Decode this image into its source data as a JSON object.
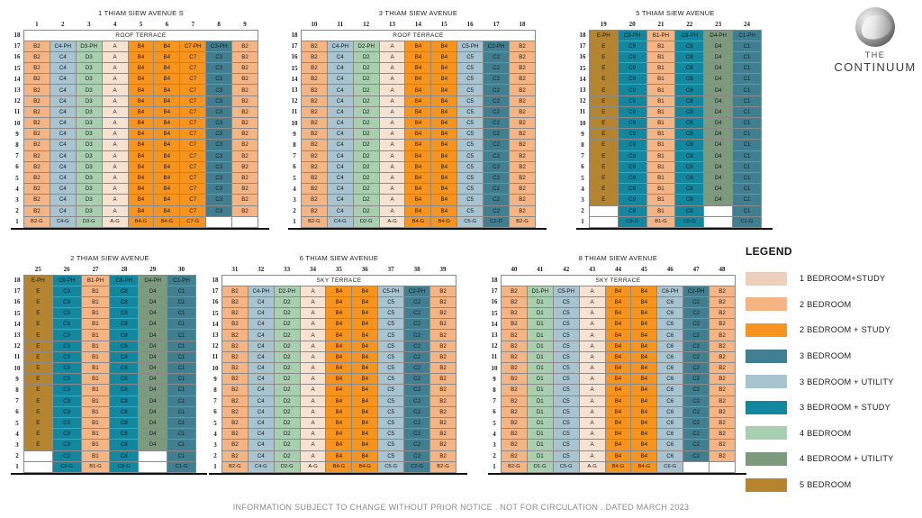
{
  "logo": {
    "line1": "THE",
    "line2": "CONTINUUM",
    "mark": "circular-swirl-logo"
  },
  "footer": {
    "text": "INFORMATION SUBJECT TO CHANGE WITHOUT PRIOR NOTICE . NOT FOR CIRCULATION . DATED MARCH 2023"
  },
  "legend": {
    "title": "LEGEND",
    "items": [
      {
        "label": "1 BEDROOM+STUDY",
        "color": "#ecd0bb"
      },
      {
        "label": "2 BEDROOM",
        "color": "#f5b483"
      },
      {
        "label": "2 BEDROOM + STUDY",
        "color": "#f7941e"
      },
      {
        "label": "3 BEDROOM",
        "color": "#3f7f91"
      },
      {
        "label": "3 BEDROOM + UTILITY",
        "color": "#a8c4d0"
      },
      {
        "label": "3 BEDROOM + STUDY",
        "color": "#1287a0"
      },
      {
        "label": "4 BEDROOM",
        "color": "#a8cfb0"
      },
      {
        "label": "4 BEDROOM + UTILITY",
        "color": "#7d9a7f"
      },
      {
        "label": "5 BEDROOM",
        "color": "#b5842f"
      }
    ]
  },
  "palette": {
    "one_bed_study": "#f7e2d2",
    "two_bed": "#f5b483",
    "two_bed_study": "#f7941e",
    "three_bed": "#3f7f91",
    "three_bed_utility": "#a8c4d0",
    "three_bed_study": "#1287a0",
    "four_bed": "#a8cfb0",
    "four_bed_utility": "#7d9a7f",
    "five_bed": "#b5842f",
    "empty": "#ffffff"
  },
  "unit_colors": {
    "A": "#f7e2d2",
    "B1": "#f5b483",
    "B2": "#f5b483",
    "B4": "#f7941e",
    "C1": "#3f7f91",
    "C2": "#3f7f91",
    "C3": "#3f7f91",
    "C4": "#a8c4d0",
    "C5": "#a8c4d0",
    "C6": "#a8c4d0",
    "C7": "#f7941e",
    "C8": "#1287a0",
    "C9": "#1287a0",
    "D1": "#a8cfb0",
    "D2": "#a8cfb0",
    "D3": "#a8cfb0",
    "D4": "#7d9a7f",
    "E": "#b5842f"
  },
  "blocks": [
    {
      "id": "block-1-thiam-siew-avenue-s",
      "title": "1 THIAM SIEW AVENUE S",
      "columns": [
        "1",
        "2",
        "3",
        "4",
        "5",
        "6",
        "7",
        "8",
        "9"
      ],
      "terrace_label": "ROOF TERRACE",
      "terrace_row": "18",
      "rows": [
        "17",
        "16",
        "15",
        "14",
        "13",
        "12",
        "11",
        "10",
        "9",
        "8",
        "7",
        "6",
        "5",
        "4",
        "3",
        "2"
      ],
      "ground_row": "1",
      "ph": [
        "B2",
        "C4-PH",
        "D3-PH",
        "A",
        "B4",
        "B4",
        "C7-PH",
        "C3-PH",
        "B2"
      ],
      "typical": [
        "B2",
        "C4",
        "D3",
        "A",
        "B4",
        "B4",
        "C7",
        "C3",
        "B2"
      ],
      "ground": [
        "B2-G",
        "C4-G",
        "D3-G",
        "A-G",
        "B4-G",
        "B4-G",
        "C7-G",
        "",
        ""
      ],
      "types": [
        "B2",
        "C4",
        "D3",
        "A",
        "B4",
        "B4",
        "C7",
        "C3",
        "B2"
      ]
    },
    {
      "id": "block-3-thiam-siew-avenue",
      "title": "3 THIAM SIEW AVENUE",
      "columns": [
        "10",
        "11",
        "12",
        "13",
        "14",
        "15",
        "16",
        "17",
        "18"
      ],
      "terrace_label": "ROOF TERRACE",
      "terrace_row": "18",
      "rows": [
        "17",
        "16",
        "15",
        "14",
        "13",
        "12",
        "11",
        "10",
        "9",
        "8",
        "7",
        "6",
        "5",
        "4",
        "3",
        "2"
      ],
      "ground_row": "1",
      "ph": [
        "B2",
        "C4-PH",
        "D2-PH",
        "A",
        "B4",
        "B4",
        "C5-PH",
        "C2-PH",
        "B2"
      ],
      "typical": [
        "B2",
        "C4",
        "D2",
        "A",
        "B4",
        "B4",
        "C5",
        "C2",
        "B2"
      ],
      "ground": [
        "B2-G",
        "C4-G",
        "D2-G",
        "A-G",
        "B4-G",
        "B4-G",
        "C5-G",
        "C2-G",
        "B2-G"
      ],
      "types": [
        "B2",
        "C4",
        "D2",
        "A",
        "B4",
        "B4",
        "C5",
        "C2",
        "B2"
      ]
    },
    {
      "id": "block-5-thiam-siew-avenue",
      "title": "5 THIAM SIEW AVENUE",
      "columns": [
        "19",
        "20",
        "21",
        "22",
        "23",
        "24"
      ],
      "terrace_label": "",
      "terrace_row": "18",
      "rows": [
        "17",
        "16",
        "15",
        "14",
        "13",
        "12",
        "11",
        "10",
        "9",
        "8",
        "7",
        "6",
        "5",
        "4",
        "3",
        "2"
      ],
      "ground_row": "1",
      "ph": [
        "E-PH",
        "C9-PH",
        "B1-PH",
        "C8-PH",
        "D4-PH",
        "C1-PH"
      ],
      "typical": [
        "E",
        "C9",
        "B1",
        "C8",
        "D4",
        "C1"
      ],
      "second": [
        "",
        "C9",
        "B1",
        "C8",
        "",
        "C1"
      ],
      "ground": [
        "",
        "C9-G",
        "B1-G",
        "C8-G",
        "",
        "C1-G"
      ],
      "types": [
        "E",
        "C9",
        "B1",
        "C8",
        "D4",
        "C1"
      ]
    },
    {
      "id": "block-2-thiam-siew-avenue",
      "title": "2 THIAM SIEW AVENUE",
      "columns": [
        "25",
        "26",
        "27",
        "28",
        "29",
        "30"
      ],
      "terrace_label": "",
      "terrace_row": "18",
      "rows": [
        "17",
        "16",
        "15",
        "14",
        "13",
        "12",
        "11",
        "10",
        "9",
        "8",
        "7",
        "6",
        "5",
        "4",
        "3",
        "2"
      ],
      "ground_row": "1",
      "ph": [
        "E-PH",
        "C9-PH",
        "B1-PH",
        "C8-PH",
        "D4-PH",
        "C1-PH"
      ],
      "typical": [
        "E",
        "C9",
        "B1",
        "C8",
        "D4",
        "C1"
      ],
      "second": [
        "",
        "C9",
        "B1",
        "C8",
        "",
        "C1"
      ],
      "ground": [
        "",
        "C9-G",
        "B1-G",
        "C8-G",
        "",
        "C1-G"
      ],
      "types": [
        "E",
        "C9",
        "B1",
        "C8",
        "D4",
        "C1"
      ]
    },
    {
      "id": "block-6-thiam-siew-avenue",
      "title": "6 THIAM SIEW AVENUE",
      "columns": [
        "31",
        "32",
        "33",
        "34",
        "35",
        "36",
        "37",
        "38",
        "39"
      ],
      "terrace_label": "SKY TERRACE",
      "terrace_row": "18",
      "rows": [
        "17",
        "16",
        "15",
        "14",
        "13",
        "12",
        "11",
        "10",
        "9",
        "8",
        "7",
        "6",
        "5",
        "4",
        "3",
        "2"
      ],
      "ground_row": "1",
      "ph": [
        "B2",
        "C4-PH",
        "D2-PH",
        "A",
        "B4",
        "B4",
        "C5-PH",
        "C2-PH",
        "B2"
      ],
      "typical": [
        "B2",
        "C4",
        "D2",
        "A",
        "B4",
        "B4",
        "C5",
        "C2",
        "B2"
      ],
      "ground": [
        "B2-G",
        "C4-G",
        "D2-G",
        "A-G",
        "B4-G",
        "B4-G",
        "C5-G",
        "C2-G",
        "B2-G"
      ],
      "types": [
        "B2",
        "C4",
        "D2",
        "A",
        "B4",
        "B4",
        "C5",
        "C2",
        "B2"
      ]
    },
    {
      "id": "block-8-thiam-siew-avenue",
      "title": "8 THIAM SIEW AVENUE",
      "columns": [
        "40",
        "41",
        "42",
        "43",
        "44",
        "45",
        "46",
        "47",
        "48"
      ],
      "terrace_label": "SKY TERRACE",
      "terrace_row": "18",
      "rows": [
        "17",
        "16",
        "15",
        "14",
        "13",
        "12",
        "11",
        "10",
        "9",
        "8",
        "7",
        "6",
        "5",
        "4",
        "3",
        "2"
      ],
      "ground_row": "1",
      "ph": [
        "B2",
        "D1-PH",
        "C5-PH",
        "A",
        "B4",
        "B4",
        "C6-PH",
        "C2-PH",
        "B2"
      ],
      "typical": [
        "B2",
        "D1",
        "C5",
        "A",
        "B4",
        "B4",
        "C6",
        "C2",
        "B2"
      ],
      "ground": [
        "B2-G",
        "D1-G",
        "C5-G",
        "A-G",
        "B4-G",
        "B4-G",
        "C6-G",
        "",
        ""
      ],
      "types": [
        "B2",
        "D1",
        "C5",
        "A",
        "B4",
        "B4",
        "C6",
        "C2",
        "B2"
      ]
    }
  ]
}
